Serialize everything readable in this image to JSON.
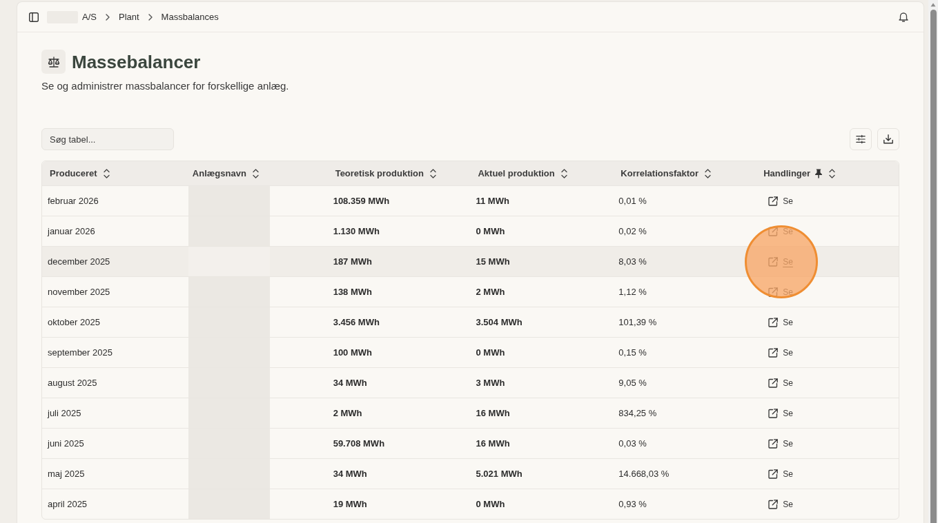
{
  "topbar": {
    "breadcrumbs": [
      {
        "label": "A/S",
        "redacted": true
      },
      {
        "label": "Plant",
        "redacted": false
      },
      {
        "label": "Massbalances",
        "redacted": false
      }
    ]
  },
  "page_header": {
    "title": "Massebalancer",
    "subtitle": "Se og administrer massbalancer for forskellige anlæg."
  },
  "search": {
    "placeholder": "Søg tabel..."
  },
  "table": {
    "columns": [
      {
        "label": "Produceret",
        "kind": "text",
        "pinned": false
      },
      {
        "label": "Anlægsnavn",
        "kind": "redacted",
        "pinned": false
      },
      {
        "label": "Teoretisk produktion",
        "kind": "quantity",
        "pinned": false
      },
      {
        "label": "Aktuel produktion",
        "kind": "quantity",
        "pinned": false
      },
      {
        "label": "Korrelationsfaktor",
        "kind": "text",
        "pinned": false
      },
      {
        "label": "Handlinger",
        "kind": "action",
        "pinned": true
      }
    ],
    "rows": [
      {
        "cells": [
          "februar 2026",
          "",
          "108.359 MWh",
          "11 MWh",
          "0,01 %",
          "Se"
        ],
        "hovered": false,
        "clicked": false
      },
      {
        "cells": [
          "januar 2026",
          "",
          "1.130 MWh",
          "0 MWh",
          "0,02 %",
          "Se"
        ],
        "hovered": false,
        "clicked": false
      },
      {
        "cells": [
          "december 2025",
          "",
          "187 MWh",
          "15 MWh",
          "8,03 %",
          "Se"
        ],
        "hovered": true,
        "clicked": true
      },
      {
        "cells": [
          "november 2025",
          "",
          "138 MWh",
          "2 MWh",
          "1,12 %",
          "Se"
        ],
        "hovered": false,
        "clicked": false
      },
      {
        "cells": [
          "oktober 2025",
          "",
          "3.456 MWh",
          "3.504 MWh",
          "101,39 %",
          "Se"
        ],
        "hovered": false,
        "clicked": false
      },
      {
        "cells": [
          "september 2025",
          "",
          "100 MWh",
          "0 MWh",
          "0,15 %",
          "Se"
        ],
        "hovered": false,
        "clicked": false
      },
      {
        "cells": [
          "august 2025",
          "",
          "34 MWh",
          "3 MWh",
          "9,05 %",
          "Se"
        ],
        "hovered": false,
        "clicked": false
      },
      {
        "cells": [
          "juli 2025",
          "",
          "2 MWh",
          "16 MWh",
          "834,25 %",
          "Se"
        ],
        "hovered": false,
        "clicked": false
      },
      {
        "cells": [
          "juni 2025",
          "",
          "59.708 MWh",
          "16 MWh",
          "0,03 %",
          "Se"
        ],
        "hovered": false,
        "clicked": false
      },
      {
        "cells": [
          "maj 2025",
          "",
          "34 MWh",
          "5.021 MWh",
          "14.668,03 %",
          "Se"
        ],
        "hovered": false,
        "clicked": false
      },
      {
        "cells": [
          "april 2025",
          "",
          "19 MWh",
          "0 MWh",
          "0,93 %",
          "Se"
        ],
        "hovered": false,
        "clicked": false
      }
    ]
  }
}
